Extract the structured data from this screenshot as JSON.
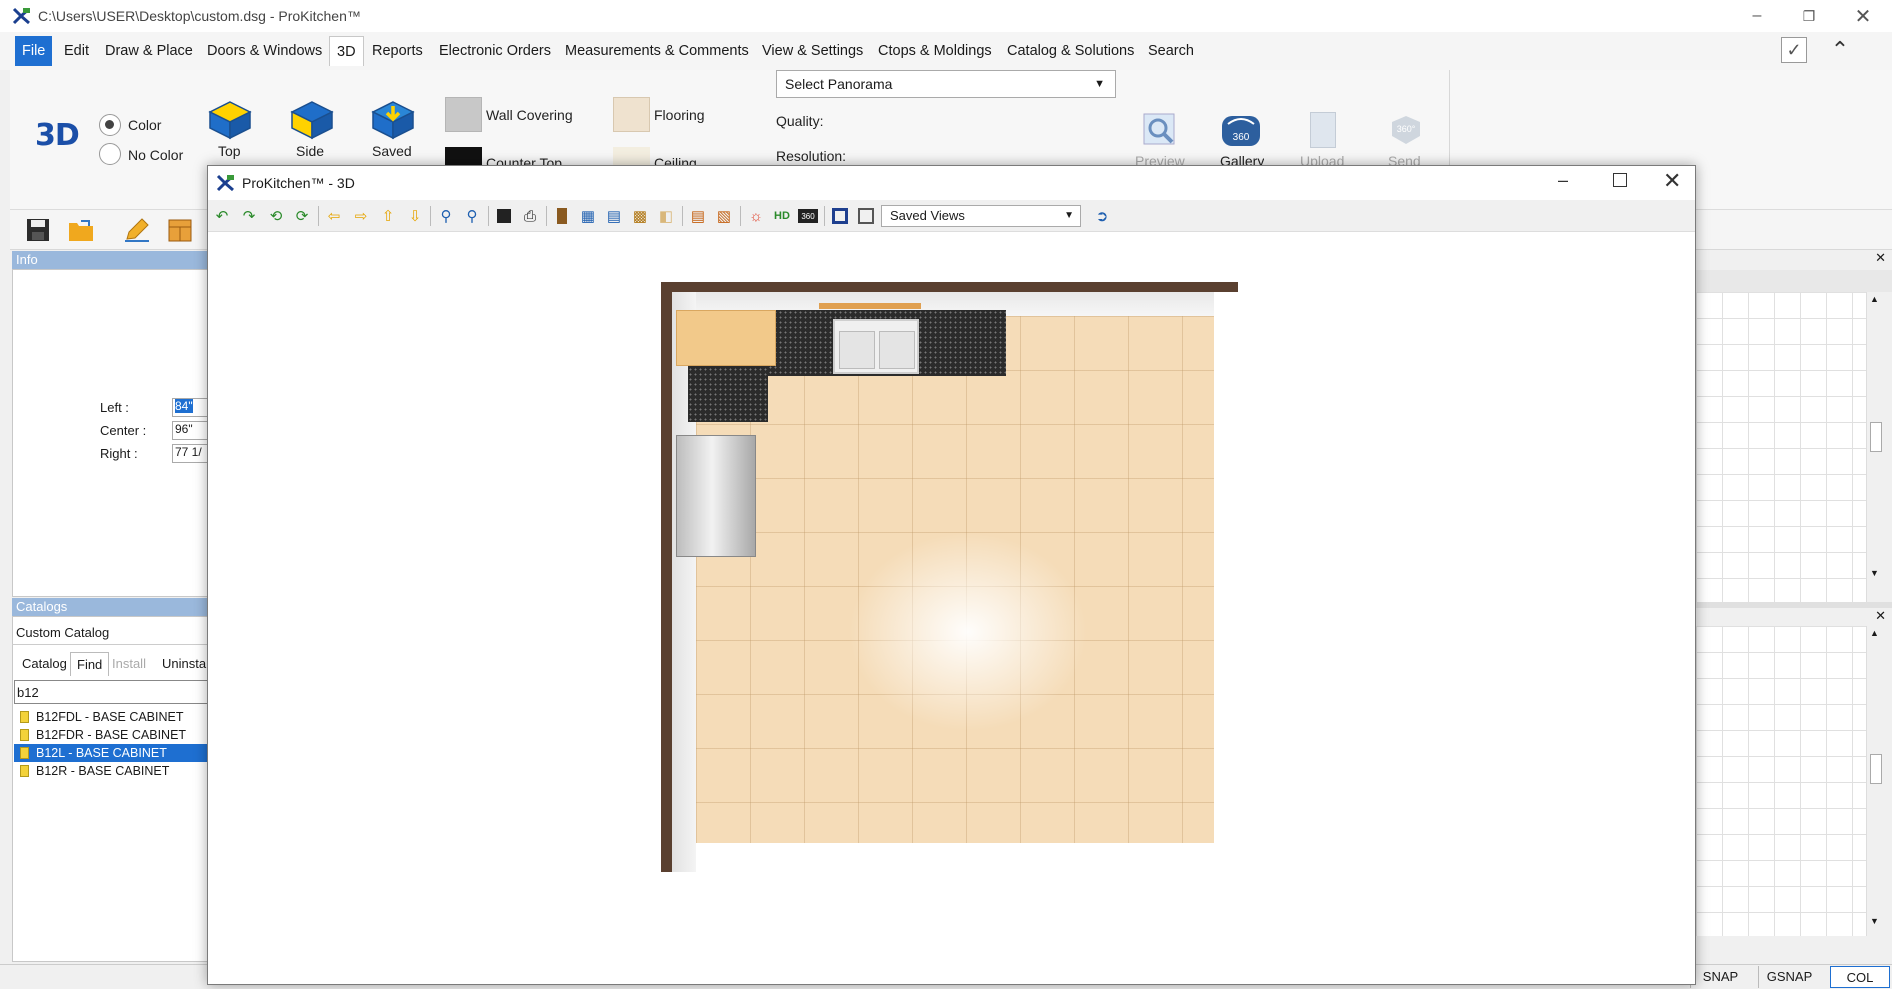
{
  "titlebar": {
    "title": "C:\\Users\\USER\\Desktop\\custom.dsg - ProKitchen™"
  },
  "menu": {
    "items": [
      "File",
      "Edit",
      "Draw & Place",
      "Doors & Windows",
      "3D",
      "Reports",
      "Electronic Orders",
      "Measurements & Comments",
      "View & Settings",
      "Ctops & Moldings",
      "Catalog & Solutions",
      "Search"
    ],
    "active": "3D"
  },
  "ribbon": {
    "logo": "3D",
    "color_option": "Color",
    "no_color_option": "No Color",
    "buttons": {
      "top": "Top",
      "side": "Side",
      "saved": "Saved"
    },
    "wall_covering": "Wall Covering",
    "flooring": "Flooring",
    "counter_top": "Counter Top",
    "ceiling": "Ceiling",
    "panorama_select": "Select Panorama",
    "quality_label": "Quality:",
    "resolution_label": "Resolution:",
    "actions": {
      "preview": "Preview",
      "gallery": "Gallery",
      "upload": "Upload",
      "send": "Send"
    },
    "badge_360": "360",
    "badge_360_send": "360°"
  },
  "info_panel": {
    "title": "Info",
    "left_label": "Left :",
    "left_value": "84\"",
    "center_label": "Center :",
    "center_value": "96\"",
    "right_label": "Right :",
    "right_value": "77 1/"
  },
  "catalogs_panel": {
    "title": "Catalogs",
    "catalog_name": "Custom Catalog",
    "tabs": [
      "Catalog",
      "Find",
      "Install",
      "Uninstal"
    ],
    "active_tab": "Find",
    "search_value": "b12",
    "results": [
      "B12FDL - BASE CABINET",
      "B12FDR - BASE CABINET",
      "B12L - BASE CABINET",
      "B12R - BASE CABINET"
    ],
    "selected_result": "B12L - BASE CABINET"
  },
  "window3d": {
    "title": "ProKitchen™ - 3D",
    "saved_views": "Saved Views",
    "tool_hd": "HD",
    "tool_360": "360"
  },
  "status": {
    "cells": [
      "SNAP",
      "GSNAP",
      "COL"
    ]
  },
  "colors": {
    "accent": "#1e6fd1",
    "panel_header": "#9ab8dc",
    "selection": "#1e6fd1",
    "wall": "#5a4030",
    "floor": "#f5dcb8",
    "countertop": "#2b2b2b"
  }
}
